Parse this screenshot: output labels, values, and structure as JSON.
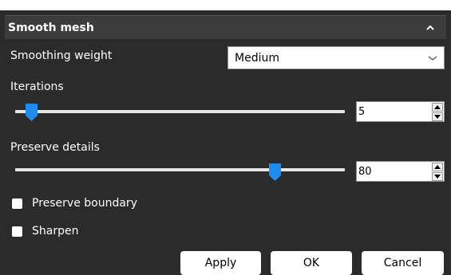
{
  "panel": {
    "title": "Smooth mesh",
    "collapse_icon": "chevron-up-icon"
  },
  "smoothing_weight": {
    "label": "Smoothing weight",
    "selected": "Medium"
  },
  "iterations": {
    "label": "Iterations",
    "value": "5"
  },
  "preserve_details": {
    "label": "Preserve details",
    "value": "80"
  },
  "checkboxes": {
    "preserve_boundary": {
      "label": "Preserve boundary",
      "checked": false
    },
    "sharpen": {
      "label": "Sharpen",
      "checked": false
    }
  },
  "buttons": {
    "apply": "Apply",
    "ok": "OK",
    "cancel": "Cancel"
  },
  "colors": {
    "slider_thumb": "#1e8cf0",
    "panel_bg": "#2b2b2b",
    "header_bg": "#3c3c3c"
  }
}
